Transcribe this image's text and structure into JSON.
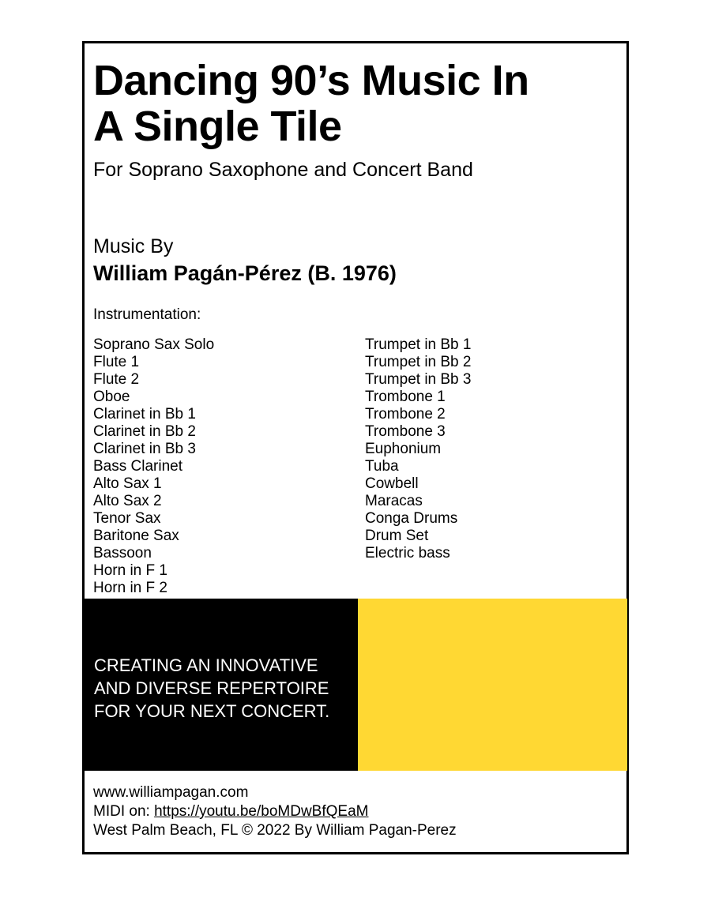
{
  "cover": {
    "title": "Dancing 90’s Music In\nA Single Tile",
    "subtitle": "For Soprano Saxophone and Concert Band",
    "music_by_label": "Music By",
    "composer": "William Pagán-Pérez (B. 1976)",
    "instrumentation_heading": "Instrumentation:",
    "instrumentation": {
      "left_column": [
        "Soprano Sax Solo",
        "Flute 1",
        "Flute 2",
        "Oboe",
        "Clarinet in Bb 1",
        "Clarinet in Bb 2",
        "Clarinet in Bb 3",
        "Bass Clarinet",
        "Alto Sax 1",
        "Alto Sax 2",
        "Tenor Sax",
        "Baritone Sax",
        "Bassoon",
        "Horn in F 1",
        "Horn in F 2"
      ],
      "right_column": [
        "Trumpet in Bb 1",
        "Trumpet in Bb 2",
        "Trumpet in Bb 3",
        "Trombone 1",
        "Trombone 2",
        "Trombone 3",
        "Euphonium",
        "Tuba",
        "Cowbell",
        "Maracas",
        "Conga Drums",
        "Drum Set",
        "Electric bass"
      ]
    },
    "banner": {
      "tagline": "CREATING AN INNOVATIVE\nAND DIVERSE REPERTOIRE\nFOR YOUR NEXT CONCERT.",
      "black_color": "#000000",
      "yellow_color": "#FFD833",
      "tagline_color": "#FFFFFF"
    },
    "footer": {
      "website": "www.williampagan.com",
      "midi_label": "MIDI on: ",
      "midi_url": "https://youtu.be/boMDwBfQEaM",
      "copyright": "West Palm Beach, FL © 2022 By William Pagan-Perez"
    }
  }
}
